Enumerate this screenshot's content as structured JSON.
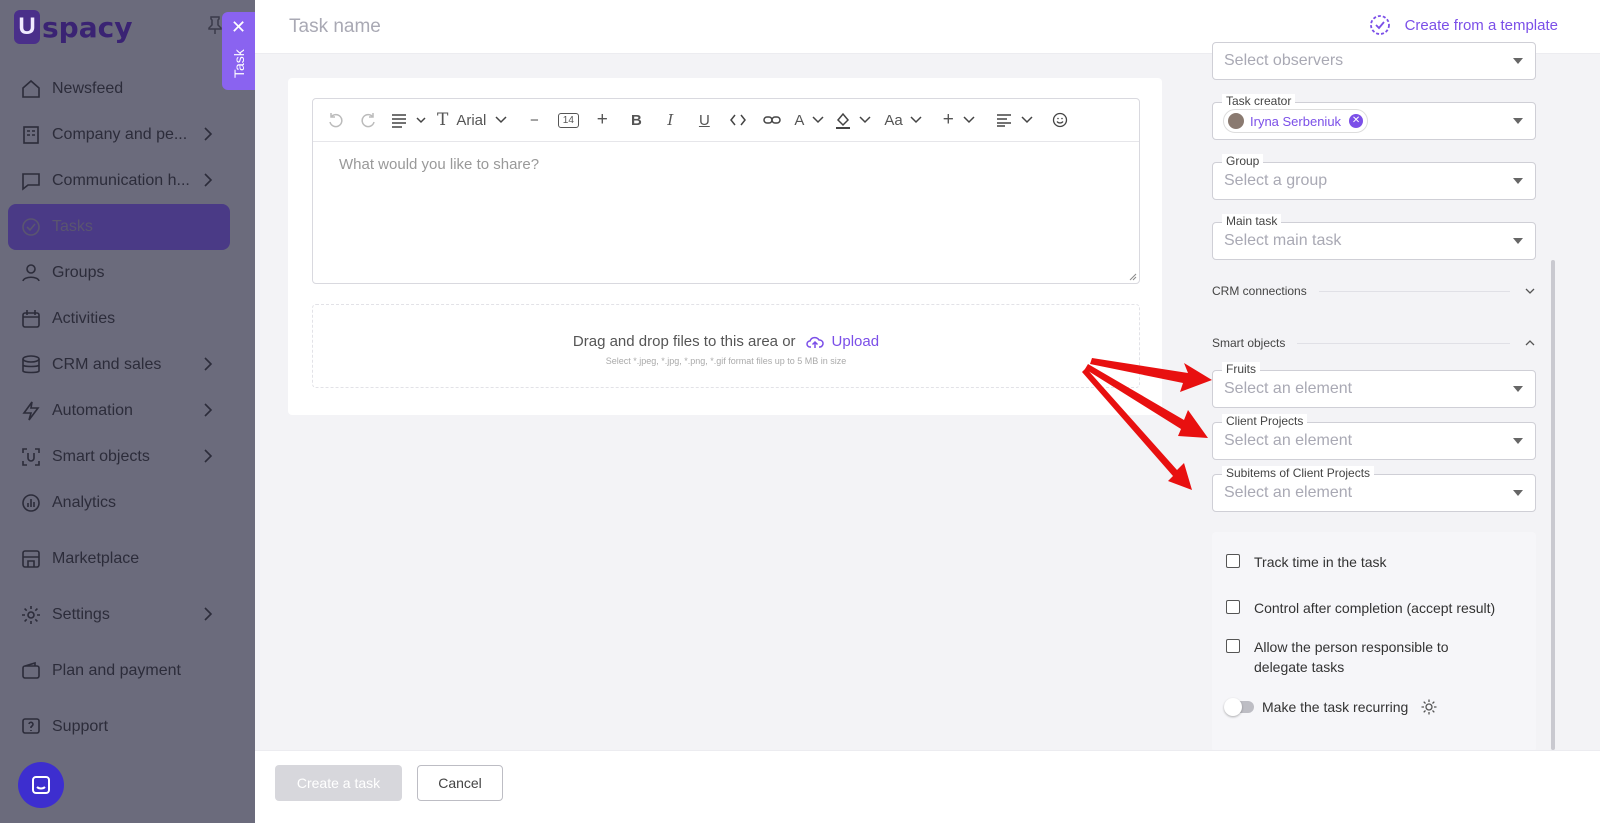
{
  "brand": {
    "logo_mark": "U",
    "logo_text": "spacy"
  },
  "sidebar": {
    "items": [
      {
        "label": "Newsfeed",
        "icon": "home-icon",
        "chevron": false
      },
      {
        "label": "Company and pe...",
        "icon": "building-icon",
        "chevron": true
      },
      {
        "label": "Communication h...",
        "icon": "chat-icon",
        "chevron": true
      },
      {
        "label": "Tasks",
        "icon": "check-circle-icon",
        "chevron": false,
        "active": true
      },
      {
        "label": "Groups",
        "icon": "users-icon",
        "chevron": false
      },
      {
        "label": "Activities",
        "icon": "calendar-icon",
        "chevron": false
      },
      {
        "label": "CRM and sales",
        "icon": "database-icon",
        "chevron": true
      },
      {
        "label": "Automation",
        "icon": "bolt-icon",
        "chevron": true
      },
      {
        "label": "Smart objects",
        "icon": "smart-object-icon",
        "chevron": true
      },
      {
        "label": "Analytics",
        "icon": "chart-icon",
        "chevron": false
      },
      {
        "label": "Marketplace",
        "icon": "store-icon",
        "chevron": false
      },
      {
        "label": "Settings",
        "icon": "gear-icon",
        "chevron": true
      },
      {
        "label": "Plan and payment",
        "icon": "wallet-icon",
        "chevron": false
      },
      {
        "label": "Support",
        "icon": "help-icon",
        "chevron": false
      }
    ]
  },
  "task_tab": {
    "close": "✕",
    "label": "Task"
  },
  "header": {
    "task_name_placeholder": "Task name",
    "template_link": "Create from a template"
  },
  "editor": {
    "font": "Arial",
    "font_size": "14",
    "placeholder": "What would you like to share?"
  },
  "dropzone": {
    "text": "Drag and drop files to this area or",
    "upload": "Upload",
    "hint": "Select *.jpeg, *.jpg, *.png, *.gif format files up to 5 MB in size"
  },
  "fields": {
    "observers": {
      "placeholder": "Select observers"
    },
    "task_creator": {
      "label": "Task creator",
      "value": "Iryna Serbeniuk"
    },
    "group": {
      "label": "Group",
      "placeholder": "Select a group"
    },
    "main_task": {
      "label": "Main task",
      "placeholder": "Select main task"
    },
    "crm_section": "CRM connections",
    "smart_section": "Smart objects",
    "fruits": {
      "label": "Fruits",
      "placeholder": "Select an element"
    },
    "client_projects": {
      "label": "Client Projects",
      "placeholder": "Select an element"
    },
    "subitems": {
      "label": "Subitems of Client Projects",
      "placeholder": "Select an element"
    }
  },
  "options": {
    "track_time": "Track time in the task",
    "control": "Control after completion (accept result)",
    "delegate_1": "Allow the person responsible to",
    "delegate_2": "delegate tasks",
    "recurring": "Make the task recurring"
  },
  "footer": {
    "create": "Create a task",
    "cancel": "Cancel"
  },
  "colors": {
    "accent": "#7b4fe8",
    "overlay": "#7d7d8e",
    "arrow": "#e81010"
  }
}
